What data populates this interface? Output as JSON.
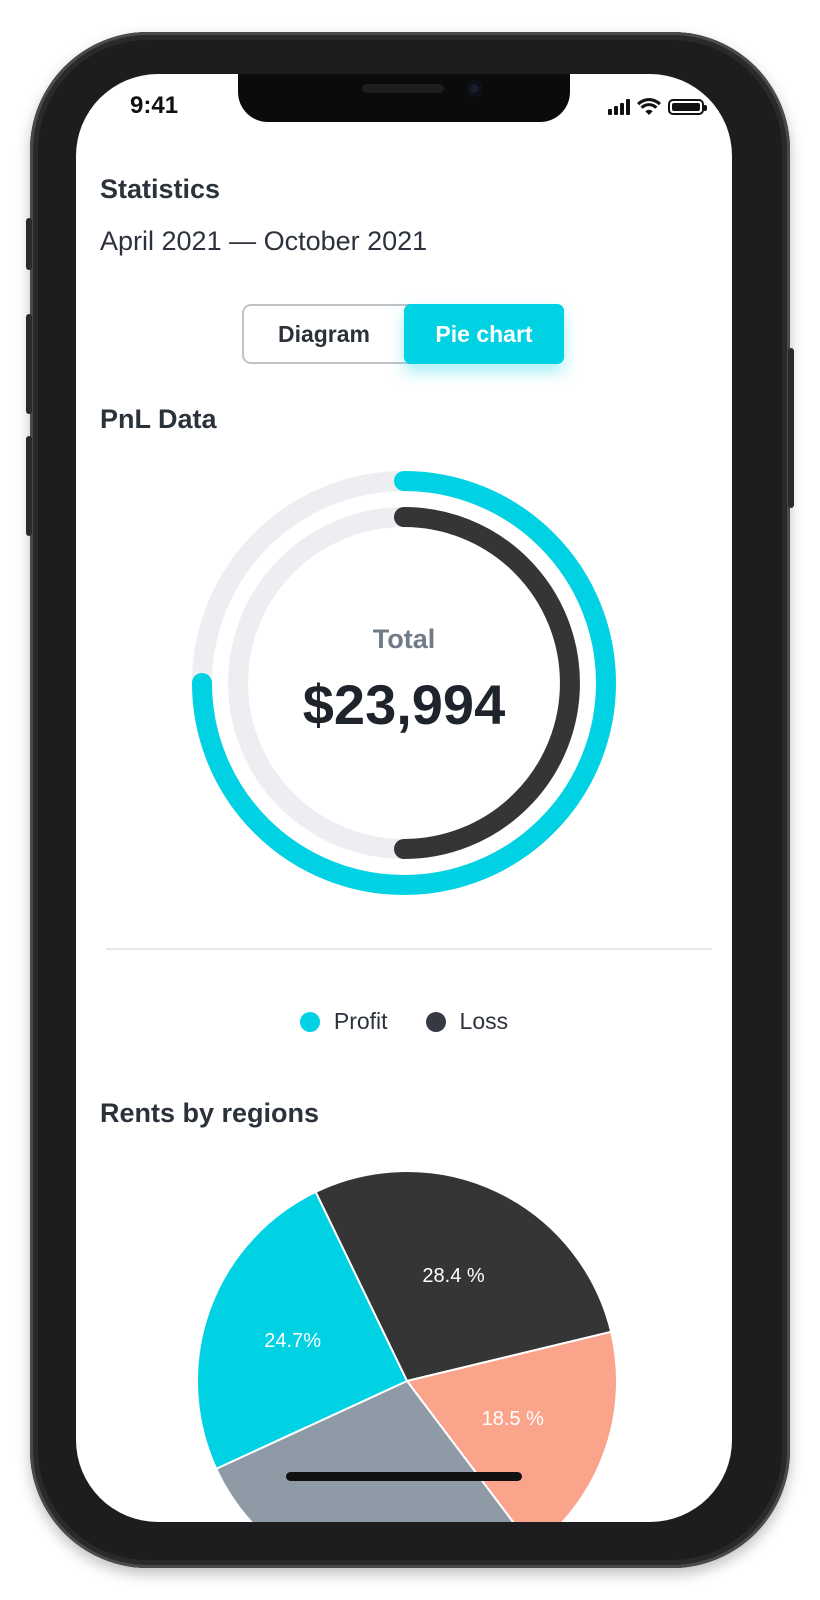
{
  "status": {
    "time": "9:41"
  },
  "header": {
    "title": "Statistics",
    "date_range": "April 2021 — October 2021"
  },
  "view_toggle": {
    "options": [
      "Diagram",
      "Pie chart"
    ],
    "selected": "Pie chart"
  },
  "pnl": {
    "title": "PnL Data",
    "total_label": "Total",
    "total_value": "$23,994",
    "legend": [
      {
        "label": "Profit",
        "color": "#00d2e3"
      },
      {
        "label": "Loss",
        "color": "#353a42"
      }
    ]
  },
  "rents": {
    "title": "Rents by regions"
  },
  "colors": {
    "accent": "#00d2e3",
    "dark": "#353535",
    "track": "#edeef1",
    "salmon": "#fba48c",
    "slate": "#8e9ba7"
  },
  "chart_data": [
    {
      "type": "pie",
      "series": [
        {
          "name": "Profit",
          "values": [
            0.75
          ]
        },
        {
          "name": "Loss",
          "values": [
            0.5
          ]
        }
      ]
    },
    {
      "type": "pie",
      "categories": [
        "",
        "",
        "",
        ""
      ],
      "values": [
        28.4,
        18.5,
        28.4,
        24.7
      ],
      "labels": [
        "28.4 %",
        "18.5 %",
        "",
        "24.7%"
      ]
    }
  ]
}
